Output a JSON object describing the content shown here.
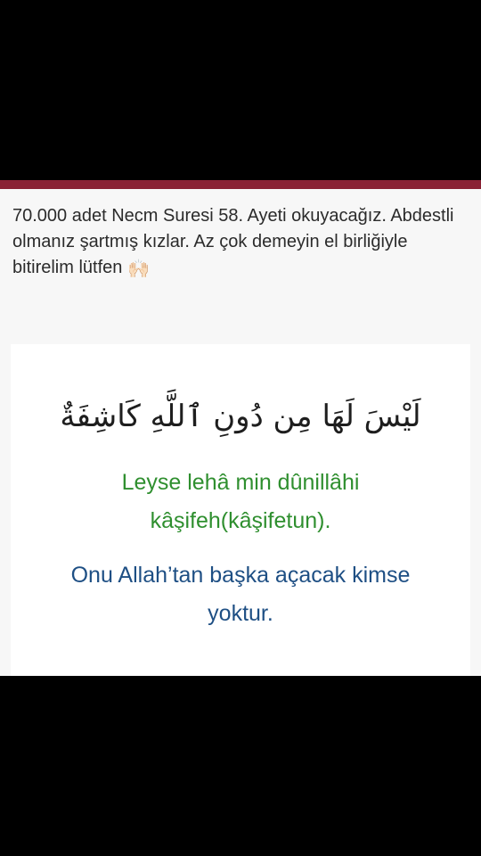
{
  "post": {
    "text": "70.000 adet Necm Suresi 58. Ayeti okuyacağız. Abdestli olmanız şartmış kızlar. Az çok demeyin el birliğiyle bitirelim lütfen",
    "emoji": "🙌🏻",
    "emoji_icon": "palms-up-hands-icon"
  },
  "verse_card": {
    "arabic": "لَيْسَ لَهَا مِن دُونِ ٱللَّهِ كَاشِفَةٌ",
    "transliteration": "Leyse lehâ min dûnillâhi kâşifeh(kâşifetun).",
    "meaning": "Onu Allah’tan başka açacak kimse yoktur."
  },
  "colors": {
    "accent_bar": "#8a2235",
    "transliteration": "#2f8f2f",
    "meaning": "#1e4f84",
    "background": "#f7f7f7",
    "card": "#ffffff"
  }
}
